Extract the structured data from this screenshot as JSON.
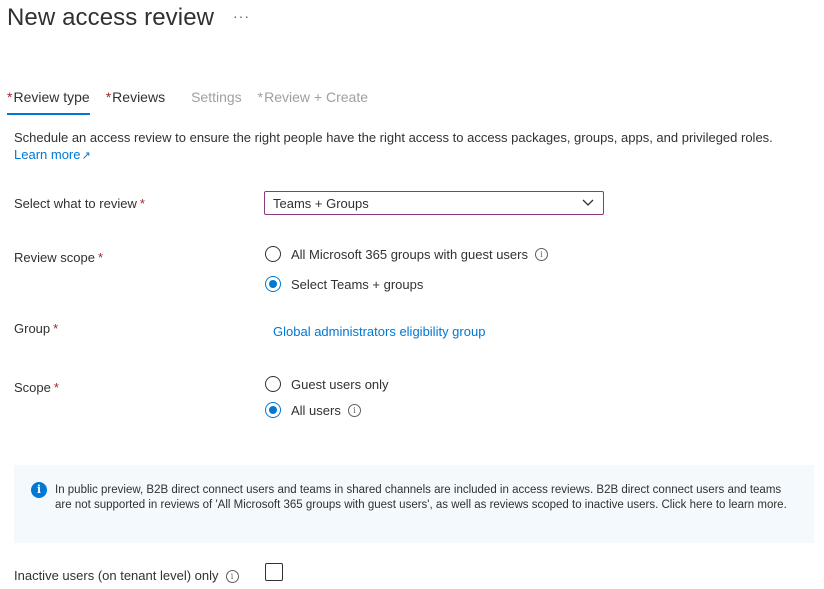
{
  "header": {
    "title": "New access review",
    "more": "···"
  },
  "tabs": [
    {
      "label": "Review type",
      "required": "*",
      "state": "active"
    },
    {
      "label": "Reviews",
      "required": "*",
      "state": "enabled"
    },
    {
      "label": "Settings",
      "required": "",
      "state": "disabled"
    },
    {
      "label": "Review + Create",
      "required": "*",
      "state": "disabled"
    }
  ],
  "description": {
    "text": "Schedule an access review to ensure the right people have the right access to access packages, groups, apps, and privileged roles.",
    "learn_more": "Learn more"
  },
  "form": {
    "select_what": {
      "label": "Select what to review",
      "required": "*",
      "value": "Teams + Groups"
    },
    "review_scope": {
      "label": "Review scope",
      "required": "*",
      "options": [
        {
          "label": "All Microsoft 365 groups with guest users",
          "checked": false,
          "info": "i"
        },
        {
          "label": "Select Teams + groups",
          "checked": true
        }
      ]
    },
    "group": {
      "label": "Group",
      "required": "*",
      "value": "Global administrators eligibility group"
    },
    "scope": {
      "label": "Scope",
      "required": "*",
      "options": [
        {
          "label": "Guest users only",
          "checked": false
        },
        {
          "label": "All users",
          "checked": true,
          "info": "i"
        }
      ]
    },
    "inactive": {
      "label": "Inactive users (on tenant level) only",
      "info": "i",
      "checked": false
    }
  },
  "banner": {
    "icon": "info-icon",
    "text": "In public preview, B2B direct connect users and teams in shared channels are included in access reviews. B2B direct connect users and teams are not supported in reviews of 'All Microsoft 365 groups with guest users', as well as reviews scoped to inactive users. Click here to learn more."
  },
  "colors": {
    "accent": "#0078d4",
    "required": "#a4262c",
    "disabled": "#a19f9d",
    "banner_bg": "#f3f9fd",
    "dropdown_border": "#8a3a7b"
  }
}
